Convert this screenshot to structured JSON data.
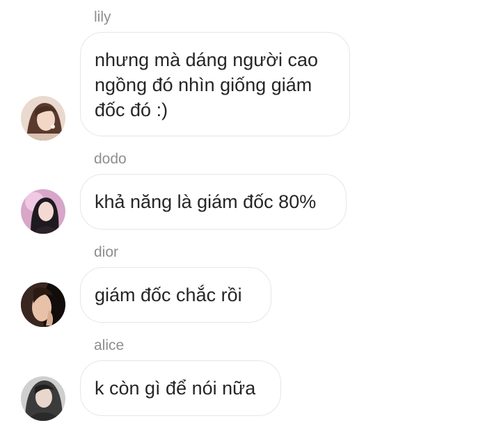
{
  "messages": [
    {
      "sender": "lily",
      "text": "nhưng mà dáng người cao\nngồng đó nhìn giống giám\nđốc đó :)",
      "avatar_icon": "profile-photo-lily"
    },
    {
      "sender": "dodo",
      "text": "khả năng là giám đốc 80%",
      "avatar_icon": "profile-photo-dodo"
    },
    {
      "sender": "dior",
      "text": "giám đốc chắc rồi",
      "avatar_icon": "profile-photo-dior"
    },
    {
      "sender": "alice",
      "text": "k còn gì để nói nữa",
      "avatar_icon": "profile-photo-alice"
    }
  ],
  "colors": {
    "background": "#ffffff",
    "sender_text": "#8e8e8e",
    "bubble_border": "#e6e6e6",
    "message_text": "#262626"
  }
}
